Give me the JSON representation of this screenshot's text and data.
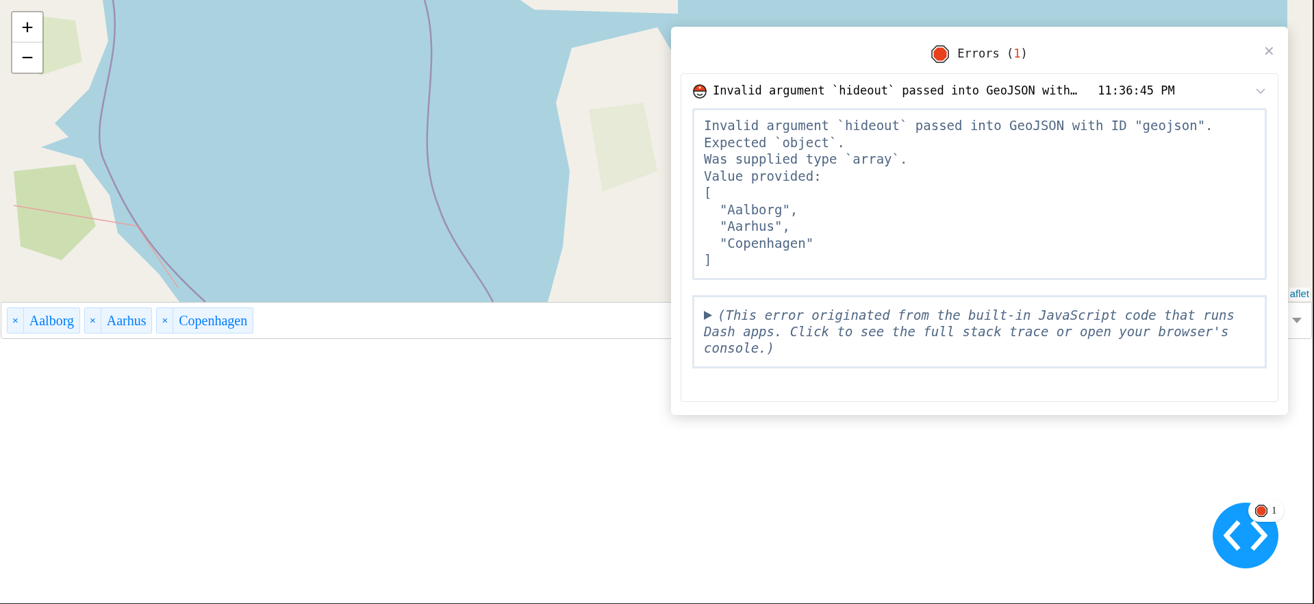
{
  "map": {
    "zoom_in": "+",
    "zoom_out": "−",
    "attribution": "aflet"
  },
  "dropdown": {
    "tags": [
      {
        "remove": "×",
        "label": "Aalborg"
      },
      {
        "remove": "×",
        "label": "Aarhus"
      },
      {
        "remove": "×",
        "label": "Copenhagen"
      }
    ]
  },
  "error_panel": {
    "title_prefix": "Errors (",
    "count": "1",
    "title_suffix": ")",
    "close": "×",
    "errors": [
      {
        "message": "Invalid argument `hideout` passed into GeoJSON with…",
        "time": "11:36:45 PM",
        "expanded": true,
        "details": "Invalid argument `hideout` passed into GeoJSON with ID \"geojson\".\nExpected `object`.\nWas supplied type `array`.\nValue provided:\n[\n  \"Aalborg\",\n  \"Aarhus\",\n  \"Copenhagen\"\n]",
        "stack_note": "(This error originated from the built-in JavaScript code that runs Dash apps. Click to see the full stack trace or open your browser's console.)"
      }
    ]
  },
  "debug_button": {
    "error_count": "1"
  }
}
